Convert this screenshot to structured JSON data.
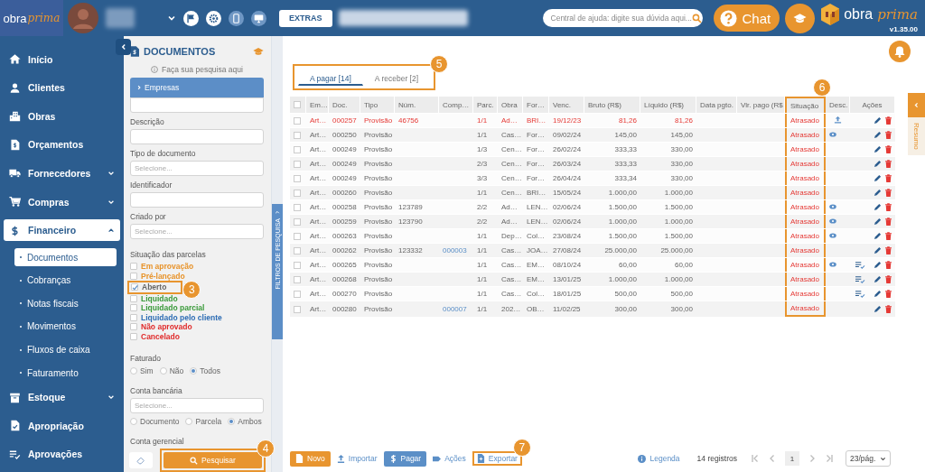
{
  "header": {
    "logo": {
      "word": "obra",
      "script": "prima"
    },
    "extras_button": "EXTRAS",
    "help_search": {
      "placeholder": "Central de ajuda: digite sua dúvida aqui..."
    },
    "chat_button": "Chat",
    "brand": {
      "word": "obra",
      "script": "prima"
    },
    "version": "v1.35.00"
  },
  "sidebar": {
    "items": [
      {
        "label": "Início"
      },
      {
        "label": "Clientes"
      },
      {
        "label": "Obras"
      },
      {
        "label": "Orçamentos"
      },
      {
        "label": "Fornecedores",
        "expanded": false
      },
      {
        "label": "Compras",
        "expanded": false
      },
      {
        "label": "Financeiro",
        "expanded": true,
        "children": [
          {
            "label": "Documentos",
            "selected": true
          },
          {
            "label": "Cobranças",
            "selected": false
          },
          {
            "label": "Notas fiscais",
            "selected": false
          },
          {
            "label": "Movimentos",
            "selected": false
          },
          {
            "label": "Fluxos de caixa",
            "selected": false
          },
          {
            "label": "Faturamento",
            "selected": false
          }
        ]
      },
      {
        "label": "Estoque",
        "expanded": false
      },
      {
        "label": "Apropriação"
      },
      {
        "label": "Aprovações"
      }
    ]
  },
  "filters": {
    "title": "DOCUMENTOS",
    "hint": "Faça sua pesquisa aqui",
    "accordion": {
      "label": "Empresas",
      "expanded": false
    },
    "fields": [
      {
        "kind": "text"
      },
      {
        "kind": "text",
        "label": "Descrição"
      },
      {
        "kind": "select",
        "label": "Tipo de documento",
        "placeholder": "Selecione..."
      },
      {
        "kind": "text",
        "label": "Identificador"
      },
      {
        "kind": "select",
        "label": "Criado por",
        "placeholder": "Selecione..."
      }
    ],
    "status_group": {
      "label": "Situação das parcelas",
      "options": [
        {
          "label": "Em aprovação",
          "checked": false,
          "color": "#e8932a"
        },
        {
          "label": "Pré-lançado",
          "checked": false,
          "color": "#e8932a"
        },
        {
          "label": "Aberto",
          "checked": true,
          "color": "#666666",
          "callout": "3"
        },
        {
          "label": "Liquidado",
          "checked": false,
          "color": "#3a9a3a"
        },
        {
          "label": "Liquidado parcial",
          "checked": false,
          "color": "#3a9a3a"
        },
        {
          "label": "Liquidado pelo cliente",
          "checked": false,
          "color": "#2e6db4"
        },
        {
          "label": "Não aprovado",
          "checked": false,
          "color": "#e02b2b"
        },
        {
          "label": "Cancelado",
          "checked": false,
          "color": "#e02b2b"
        }
      ]
    },
    "invoiced": {
      "label": "Faturado",
      "options": [
        {
          "label": "Sim",
          "selected": false
        },
        {
          "label": "Não",
          "selected": false
        },
        {
          "label": "Todos",
          "selected": true
        }
      ]
    },
    "bank_account": {
      "label": "Conta bancária",
      "placeholder": "Selecione...",
      "options": [
        {
          "label": "Documento",
          "selected": false
        },
        {
          "label": "Parcela",
          "selected": false
        },
        {
          "label": "Ambos",
          "selected": true
        }
      ]
    },
    "ledger_label": "Conta gerencial",
    "search_button": {
      "label": "Pesquisar",
      "callout": "4"
    },
    "side_tab": "FILTROS DE PESQUISA"
  },
  "tabs": {
    "callout": "5",
    "items": [
      {
        "label": "A pagar [14]",
        "selected": true
      },
      {
        "label": "A receber [2]",
        "selected": false
      }
    ]
  },
  "table": {
    "select_all": false,
    "columns": [
      {
        "label": "Em…"
      },
      {
        "label": "Doc."
      },
      {
        "label": "Tipo"
      },
      {
        "label": "Núm."
      },
      {
        "label": "Comp…"
      },
      {
        "label": "Parc."
      },
      {
        "label": "Obra"
      },
      {
        "label": "For…"
      },
      {
        "label": "Venc."
      },
      {
        "label": "Bruto (R$)"
      },
      {
        "label": "Líquido (R$)"
      },
      {
        "label": "Data pgto."
      },
      {
        "label": "Vlr. pago (R$"
      },
      {
        "label": "Situação",
        "callout": "6"
      },
      {
        "label": "Desc."
      },
      {
        "label": "Ações"
      }
    ],
    "rows": [
      {
        "selected": false,
        "highlighted": true,
        "em": "Art…",
        "doc": "000257",
        "tipo": "Provisão",
        "num": "46756",
        "parc": "1/1",
        "obra": "Ad…",
        "for": "BRI…",
        "venc": "19/12/23",
        "bruto": "81,26",
        "liquido": "81,26",
        "situacao": "Atrasado",
        "attachment": true,
        "preview": false,
        "approval": false
      },
      {
        "selected": false,
        "highlighted": false,
        "em": "Art…",
        "doc": "000250",
        "tipo": "Provisão",
        "parc": "1/1",
        "obra": "Cas…",
        "for": "For…",
        "venc": "09/02/24",
        "bruto": "145,00",
        "liquido": "145,00",
        "situacao": "Atrasado",
        "attachment": false,
        "preview": true,
        "approval": false
      },
      {
        "selected": false,
        "highlighted": false,
        "em": "Art…",
        "doc": "000249",
        "tipo": "Provisão",
        "parc": "1/3",
        "obra": "Cen…",
        "for": "For…",
        "venc": "26/02/24",
        "bruto": "333,33",
        "liquido": "330,00",
        "situacao": "Atrasado",
        "attachment": false,
        "preview": false,
        "approval": false
      },
      {
        "selected": false,
        "highlighted": false,
        "em": "Art…",
        "doc": "000249",
        "tipo": "Provisão",
        "parc": "2/3",
        "obra": "Cen…",
        "for": "For…",
        "venc": "26/03/24",
        "bruto": "333,33",
        "liquido": "330,00",
        "situacao": "Atrasado",
        "attachment": false,
        "preview": false,
        "approval": false
      },
      {
        "selected": false,
        "highlighted": false,
        "em": "Art…",
        "doc": "000249",
        "tipo": "Provisão",
        "parc": "3/3",
        "obra": "Cen…",
        "for": "For…",
        "venc": "26/04/24",
        "bruto": "333,34",
        "liquido": "330,00",
        "situacao": "Atrasado",
        "attachment": false,
        "preview": false,
        "approval": false
      },
      {
        "selected": false,
        "highlighted": false,
        "em": "Art…",
        "doc": "000260",
        "tipo": "Provisão",
        "parc": "1/1",
        "obra": "Cen…",
        "for": "BRI…",
        "venc": "15/05/24",
        "bruto": "1.000,00",
        "liquido": "1.000,00",
        "situacao": "Atrasado",
        "attachment": false,
        "preview": false,
        "approval": false
      },
      {
        "selected": false,
        "highlighted": false,
        "em": "Art…",
        "doc": "000258",
        "tipo": "Provisão",
        "num": "123789",
        "parc": "2/2",
        "obra": "Ad…",
        "for": "LEN…",
        "venc": "02/06/24",
        "bruto": "1.500,00",
        "liquido": "1.500,00",
        "situacao": "Atrasado",
        "attachment": false,
        "preview": true,
        "approval": false
      },
      {
        "selected": false,
        "highlighted": false,
        "em": "Art…",
        "doc": "000259",
        "tipo": "Provisão",
        "num": "123790",
        "parc": "2/2",
        "obra": "Ad…",
        "for": "LEN…",
        "venc": "02/06/24",
        "bruto": "1.000,00",
        "liquido": "1.000,00",
        "situacao": "Atrasado",
        "attachment": false,
        "preview": true,
        "approval": false
      },
      {
        "selected": false,
        "highlighted": false,
        "em": "Art…",
        "doc": "000263",
        "tipo": "Provisão",
        "parc": "1/1",
        "obra": "Dep…",
        "for": "Col…",
        "venc": "23/08/24",
        "bruto": "1.500,00",
        "liquido": "1.500,00",
        "situacao": "Atrasado",
        "attachment": false,
        "preview": true,
        "approval": false
      },
      {
        "selected": false,
        "highlighted": false,
        "em": "Art…",
        "doc": "000262",
        "tipo": "Provisão",
        "num": "123332",
        "comp": "000003",
        "parc": "1/1",
        "obra": "Cas…",
        "for": "JOA…",
        "venc": "27/08/24",
        "bruto": "25.000,00",
        "liquido": "25.000,00",
        "situacao": "Atrasado",
        "attachment": false,
        "preview": false,
        "approval": false
      },
      {
        "selected": false,
        "highlighted": false,
        "em": "Art…",
        "doc": "000265",
        "tipo": "Provisão",
        "parc": "1/1",
        "obra": "Cas…",
        "for": "EM…",
        "venc": "08/10/24",
        "bruto": "60,00",
        "liquido": "60,00",
        "situacao": "Atrasado",
        "attachment": false,
        "preview": true,
        "approval": true
      },
      {
        "selected": false,
        "highlighted": false,
        "em": "Art…",
        "doc": "000268",
        "tipo": "Provisão",
        "parc": "1/1",
        "obra": "Cas…",
        "for": "EM…",
        "venc": "13/01/25",
        "bruto": "1.000,00",
        "liquido": "1.000,00",
        "situacao": "Atrasado",
        "attachment": false,
        "preview": false,
        "approval": true
      },
      {
        "selected": false,
        "highlighted": false,
        "em": "Art…",
        "doc": "000270",
        "tipo": "Provisão",
        "parc": "1/1",
        "obra": "Cas…",
        "for": "Col…",
        "venc": "18/01/25",
        "bruto": "500,00",
        "liquido": "500,00",
        "situacao": "Atrasado",
        "attachment": false,
        "preview": false,
        "approval": true
      },
      {
        "selected": false,
        "highlighted": false,
        "em": "Art…",
        "doc": "000280",
        "tipo": "Provisão",
        "comp": "000007",
        "parc": "1/1",
        "obra": "202…",
        "for": "OB…",
        "venc": "11/02/25",
        "bruto": "300,00",
        "liquido": "300,00",
        "situacao": "Atrasado",
        "attachment": false,
        "preview": false,
        "approval": false
      }
    ]
  },
  "bottom_bar": {
    "actions": [
      {
        "kind": "primary",
        "label": "Novo"
      },
      {
        "kind": "link",
        "label": "Importar"
      },
      {
        "kind": "pay",
        "label": "Pagar"
      },
      {
        "kind": "link",
        "label": "Ações"
      },
      {
        "kind": "link",
        "label": "Exportar",
        "callout": "7"
      }
    ],
    "legend": "Legenda",
    "record_count": "14 registros",
    "page": "1",
    "page_size": "23/pág."
  },
  "summary_tab": "Resumo"
}
